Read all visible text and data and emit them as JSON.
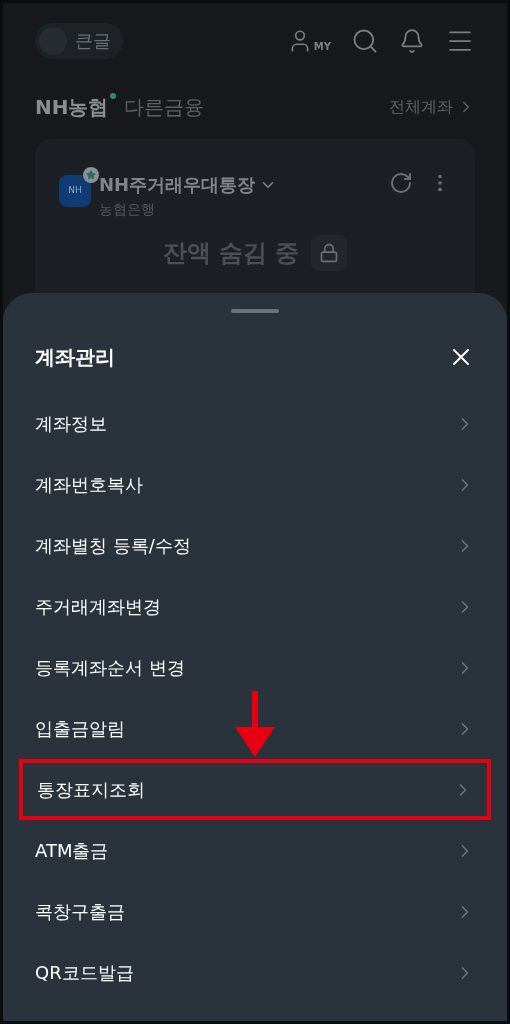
{
  "top_bar": {
    "toggle_label": "큰글",
    "toggle_on": false,
    "my_label": "MY"
  },
  "tabs": [
    {
      "label": "NH농협",
      "selected": true,
      "dot": true
    },
    {
      "label": "다른금융",
      "selected": false,
      "dot": false
    }
  ],
  "all_accounts": "전체계좌",
  "account_card": {
    "logo": "NH",
    "name": "NH주거래우대통장",
    "bank": "농협은행",
    "balance": "잔액 숨김 중"
  },
  "sheet": {
    "title": "계좌관리",
    "items": [
      {
        "label": "계좌정보",
        "highlighted": false
      },
      {
        "label": "계좌번호복사",
        "highlighted": false
      },
      {
        "label": "계좌별칭 등록/수정",
        "highlighted": false
      },
      {
        "label": "주거래계좌변경",
        "highlighted": false
      },
      {
        "label": "등록계좌순서 변경",
        "highlighted": false
      },
      {
        "label": "입출금알림",
        "highlighted": false
      },
      {
        "label": "통장표지조회",
        "highlighted": true
      },
      {
        "label": "ATM출금",
        "highlighted": false
      },
      {
        "label": "콕창구출금",
        "highlighted": false
      },
      {
        "label": "QR코드발급",
        "highlighted": false
      }
    ]
  }
}
